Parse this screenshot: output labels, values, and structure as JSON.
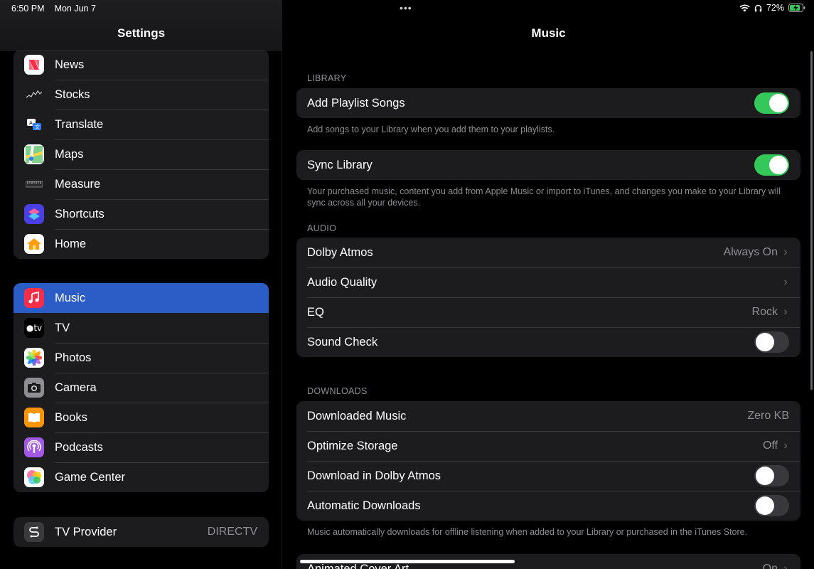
{
  "status": {
    "time": "6:50 PM",
    "date": "Mon Jun 7",
    "battery": "72%"
  },
  "sidebar": {
    "title": "Settings",
    "group1": [
      {
        "label": "News",
        "icon": "news-icon",
        "color": "#ffffff"
      },
      {
        "label": "Stocks",
        "icon": "stocks-icon",
        "color": "#1c1c1e"
      },
      {
        "label": "Translate",
        "icon": "translate-icon",
        "color": "#1c1c1e"
      },
      {
        "label": "Maps",
        "icon": "maps-icon",
        "color": "#ffffff"
      },
      {
        "label": "Measure",
        "icon": "measure-icon",
        "color": "#1c1c1e"
      },
      {
        "label": "Shortcuts",
        "icon": "shortcuts-icon",
        "color": "#4a3fe0"
      },
      {
        "label": "Home",
        "icon": "home-icon",
        "color": "#ffffff"
      }
    ],
    "group2": [
      {
        "label": "Music",
        "icon": "music-icon",
        "color": "#fa2d48"
      },
      {
        "label": "TV",
        "icon": "tv-icon",
        "color": "#000000"
      },
      {
        "label": "Photos",
        "icon": "photos-icon",
        "color": "#ffffff"
      },
      {
        "label": "Camera",
        "icon": "camera-icon",
        "color": "#8e8e93"
      },
      {
        "label": "Books",
        "icon": "books-icon",
        "color": "#ff9500"
      },
      {
        "label": "Podcasts",
        "icon": "podcasts-icon",
        "color": "#a259e6"
      },
      {
        "label": "Game Center",
        "icon": "game-center-icon",
        "color": "#ffffff"
      }
    ],
    "group3": [
      {
        "label": "TV Provider",
        "value": "DIRECTV",
        "icon": "tv-provider-icon",
        "color": "#3a3a3c"
      }
    ]
  },
  "main": {
    "title": "Music",
    "library": {
      "label": "LIBRARY",
      "add_playlist_songs": "Add Playlist Songs",
      "add_playlist_note": "Add songs to your Library when you add them to your playlists.",
      "sync_library": "Sync Library",
      "sync_note": "Your purchased music, content you add from Apple Music or import to iTunes, and changes you make to your Library will sync across all your devices."
    },
    "audio": {
      "label": "AUDIO",
      "dolby_atmos": "Dolby Atmos",
      "dolby_atmos_value": "Always On",
      "audio_quality": "Audio Quality",
      "eq": "EQ",
      "eq_value": "Rock",
      "sound_check": "Sound Check"
    },
    "downloads": {
      "label": "DOWNLOADS",
      "downloaded_music": "Downloaded Music",
      "downloaded_music_value": "Zero KB",
      "optimize_storage": "Optimize Storage",
      "optimize_storage_value": "Off",
      "download_dolby": "Download in Dolby Atmos",
      "automatic_downloads": "Automatic Downloads",
      "auto_note": "Music automatically downloads for offline listening when added to your Library or purchased in the iTunes Store."
    },
    "animated": {
      "label": "Animated Cover Art",
      "value": "On"
    }
  }
}
